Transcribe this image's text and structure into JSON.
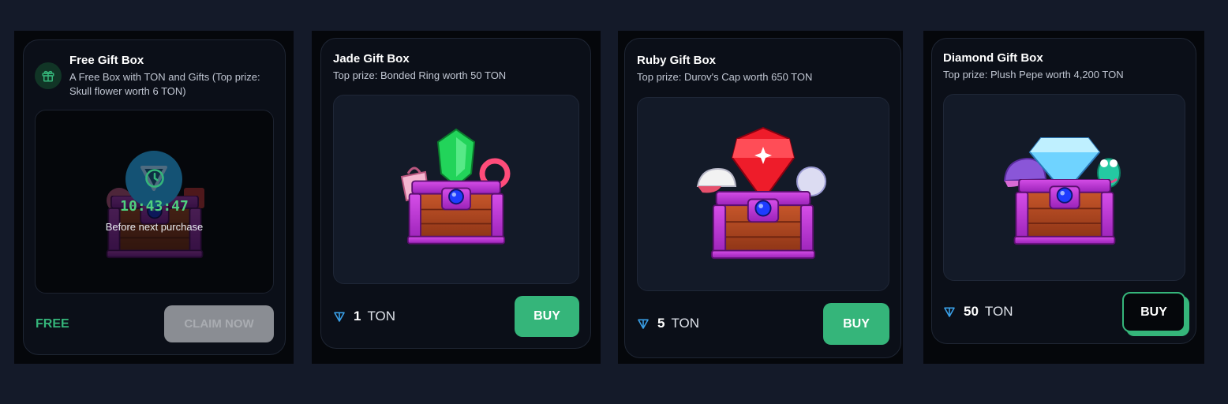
{
  "accent": "#35b57a",
  "cards": [
    {
      "title": "Free Gift Box",
      "description": "A Free Box with TON and Gifts (Top prize: Skull flower worth 6 TON)",
      "icon": "gift-icon",
      "timer": "10:43:47",
      "timer_caption": "Before next purchase",
      "price_label": "FREE",
      "button_label": "CLAIM NOW"
    },
    {
      "title": "Jade Gift Box",
      "description": "Top prize: Bonded Ring worth 50 TON",
      "price_value": "1",
      "price_unit": "TON",
      "button_label": "BUY"
    },
    {
      "title": "Ruby Gift Box",
      "description": "Top prize: Durov's Cap worth 650 TON",
      "price_value": "5",
      "price_unit": "TON",
      "button_label": "BUY"
    },
    {
      "title": "Diamond Gift Box",
      "description": "Top prize: Plush Pepe worth 4,200 TON",
      "price_value": "50",
      "price_unit": "TON",
      "button_label": "BUY"
    }
  ]
}
